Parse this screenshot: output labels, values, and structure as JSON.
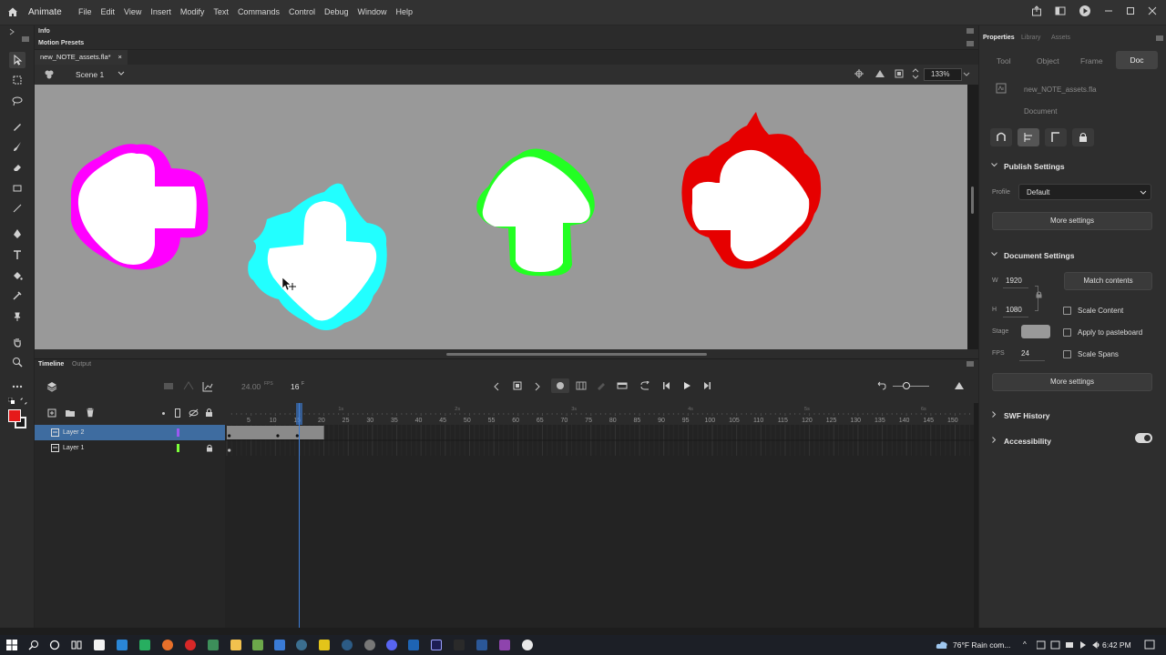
{
  "app": {
    "name": "Animate",
    "menus": [
      "File",
      "Edit",
      "View",
      "Insert",
      "Modify",
      "Text",
      "Commands",
      "Control",
      "Debug",
      "Window",
      "Help"
    ]
  },
  "panels": {
    "info": "Info",
    "motion_presets": "Motion Presets"
  },
  "document": {
    "tab_title": "new_NOTE_assets.fla*",
    "scene": "Scene 1",
    "zoom": "133%"
  },
  "stage": {
    "background": "#999999",
    "arrows": [
      {
        "name": "left-arrow",
        "outline_color": "#ff00ff"
      },
      {
        "name": "down-arrow",
        "outline_color": "#22ffff"
      },
      {
        "name": "up-arrow",
        "outline_color": "#22ff22"
      },
      {
        "name": "right-arrow",
        "outline_color": "#ff0000"
      }
    ]
  },
  "timeline": {
    "tabs": [
      "Timeline",
      "Output"
    ],
    "fps": "24.00",
    "fps_unit": "FPS",
    "current_frame": "16",
    "frame_unit": "F",
    "frame_numbers": [
      "5",
      "10",
      "15",
      "20",
      "25",
      "30",
      "35",
      "40",
      "45",
      "50",
      "55",
      "60",
      "65",
      "70",
      "75",
      "80",
      "85",
      "90",
      "95",
      "100",
      "105",
      "110",
      "115",
      "120",
      "125",
      "130",
      "135",
      "140",
      "145",
      "150"
    ],
    "seconds": [
      "1s",
      "2s",
      "3s",
      "4s",
      "5s",
      "6s"
    ],
    "layers": [
      {
        "name": "Layer 2",
        "selected": true,
        "color": "#9b59f0"
      },
      {
        "name": "Layer 1",
        "selected": false,
        "color": "#7cff3a"
      }
    ]
  },
  "properties": {
    "tabs": [
      "Properties",
      "Library",
      "Assets"
    ],
    "subtabs": [
      "Tool",
      "Object",
      "Frame",
      "Doc"
    ],
    "active_subtab": "Doc",
    "file_name": "new_NOTE_assets.fla",
    "doc_label": "Document",
    "publish_settings": {
      "title": "Publish Settings",
      "profile_label": "Profile",
      "profile_value": "Default",
      "more_settings": "More settings"
    },
    "document_settings": {
      "title": "Document Settings",
      "w_label": "W",
      "width": "1920",
      "h_label": "H",
      "height": "1080",
      "match_contents": "Match contents",
      "scale_content": "Scale Content",
      "apply_to_pasteboard": "Apply to pasteboard",
      "stage_label": "Stage",
      "stage_color": "#999999",
      "fps_label": "FPS",
      "fps": "24",
      "scale_spans": "Scale Spans",
      "more_settings": "More settings"
    },
    "swf_history": "SWF History",
    "accessibility": "Accessibility"
  },
  "taskbar": {
    "weather": "76°F Rain com...",
    "time": "6:42 PM"
  }
}
